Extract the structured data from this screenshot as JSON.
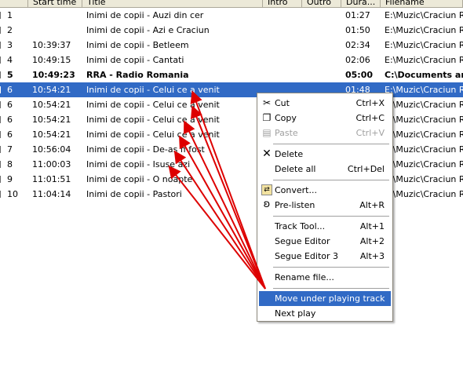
{
  "columns": {
    "start_time": "Start time",
    "title": "Title",
    "intro": "Intro",
    "outro": "Outro",
    "duration": "Dura...",
    "filename": "Filename"
  },
  "rows": [
    {
      "num": "1",
      "start": "",
      "title": "Inimi de copii - Auzi din cer",
      "intro": "",
      "outro": "",
      "dur": "01:27",
      "file": "E:\\Muzic\\Craciun Rom"
    },
    {
      "num": "2",
      "start": "",
      "title": "Inimi de copii - Azi e Craciun",
      "intro": "",
      "outro": "",
      "dur": "01:50",
      "file": "E:\\Muzic\\Craciun Rom"
    },
    {
      "num": "3",
      "start": "10:39:37",
      "title": "Inimi de copii - Betleem",
      "intro": "",
      "outro": "",
      "dur": "02:34",
      "file": "E:\\Muzic\\Craciun Rom"
    },
    {
      "num": "4",
      "start": "10:49:15",
      "title": "Inimi de copii - Cantati",
      "intro": "",
      "outro": "",
      "dur": "02:06",
      "file": "E:\\Muzic\\Craciun Rom"
    },
    {
      "num": "5",
      "start": "10:49:23",
      "title": "RRA - Radio Romania",
      "intro": "",
      "outro": "",
      "dur": "05:00",
      "file": "C:\\Documents and"
    },
    {
      "num": "6",
      "start": "10:54:21",
      "title": "Inimi de copii - Celui ce a venit",
      "intro": "",
      "outro": "",
      "dur": "01:48",
      "file": "E:\\Muzic\\Craciun Rom"
    },
    {
      "num": "6",
      "start": "10:54:21",
      "title": "Inimi de copii - Celui ce a venit",
      "intro": "",
      "outro": "",
      "dur": "",
      "file": "E:\\Muzic\\Craciun Rom"
    },
    {
      "num": "6",
      "start": "10:54:21",
      "title": "Inimi de copii - Celui ce a venit",
      "intro": "",
      "outro": "",
      "dur": "",
      "file": "E:\\Muzic\\Craciun Rom"
    },
    {
      "num": "6",
      "start": "10:54:21",
      "title": "Inimi de copii - Celui ce a venit",
      "intro": "",
      "outro": "",
      "dur": "",
      "file": "E:\\Muzic\\Craciun Rom"
    },
    {
      "num": "7",
      "start": "10:56:04",
      "title": "Inimi de copii - De-as fi fost",
      "intro": "",
      "outro": "",
      "dur": "",
      "file": "E:\\Muzic\\Craciun Rom"
    },
    {
      "num": "8",
      "start": "11:00:03",
      "title": "Inimi de copii - Isuse azi",
      "intro": "",
      "outro": "",
      "dur": "",
      "file": "E:\\Muzic\\Craciun Rom"
    },
    {
      "num": "9",
      "start": "11:01:51",
      "title": "Inimi de copii - O noapte",
      "intro": "",
      "outro": "",
      "dur": "",
      "file": "E:\\Muzic\\Craciun Rom"
    },
    {
      "num": "10",
      "start": "11:04:14",
      "title": "Inimi de copii - Pastori",
      "intro": "",
      "outro": "",
      "dur": "",
      "file": "E:\\Muzic\\Craciun Rom"
    }
  ],
  "selected_row": 5,
  "bold_row": 4,
  "context_menu": {
    "cut": {
      "label": "Cut",
      "shortcut": "Ctrl+X",
      "icon": "scissors-icon"
    },
    "copy": {
      "label": "Copy",
      "shortcut": "Ctrl+C",
      "icon": "copy-icon"
    },
    "paste": {
      "label": "Paste",
      "shortcut": "Ctrl+V",
      "icon": "paste-icon"
    },
    "delete": {
      "label": "Delete",
      "shortcut": "",
      "icon": "delete-x-icon"
    },
    "delete_all": {
      "label": "Delete all",
      "shortcut": "Ctrl+Del"
    },
    "convert": {
      "label": "Convert...",
      "shortcut": "",
      "icon": "convert-icon"
    },
    "prelisten": {
      "label": "Pre-listen",
      "shortcut": "Alt+R",
      "icon": "ear-icon"
    },
    "track_tool": {
      "label": "Track Tool...",
      "shortcut": "Alt+1"
    },
    "segue_editor": {
      "label": "Segue Editor",
      "shortcut": "Alt+2"
    },
    "segue_editor3": {
      "label": "Segue Editor 3",
      "shortcut": "Alt+3"
    },
    "rename_file": {
      "label": "Rename file..."
    },
    "move_under": {
      "label": "Move under playing track"
    },
    "next_play": {
      "label": "Next play"
    }
  },
  "colors": {
    "selection": "#316ac5",
    "arrow": "#dd0000",
    "header_bg": "#ece9d8"
  }
}
